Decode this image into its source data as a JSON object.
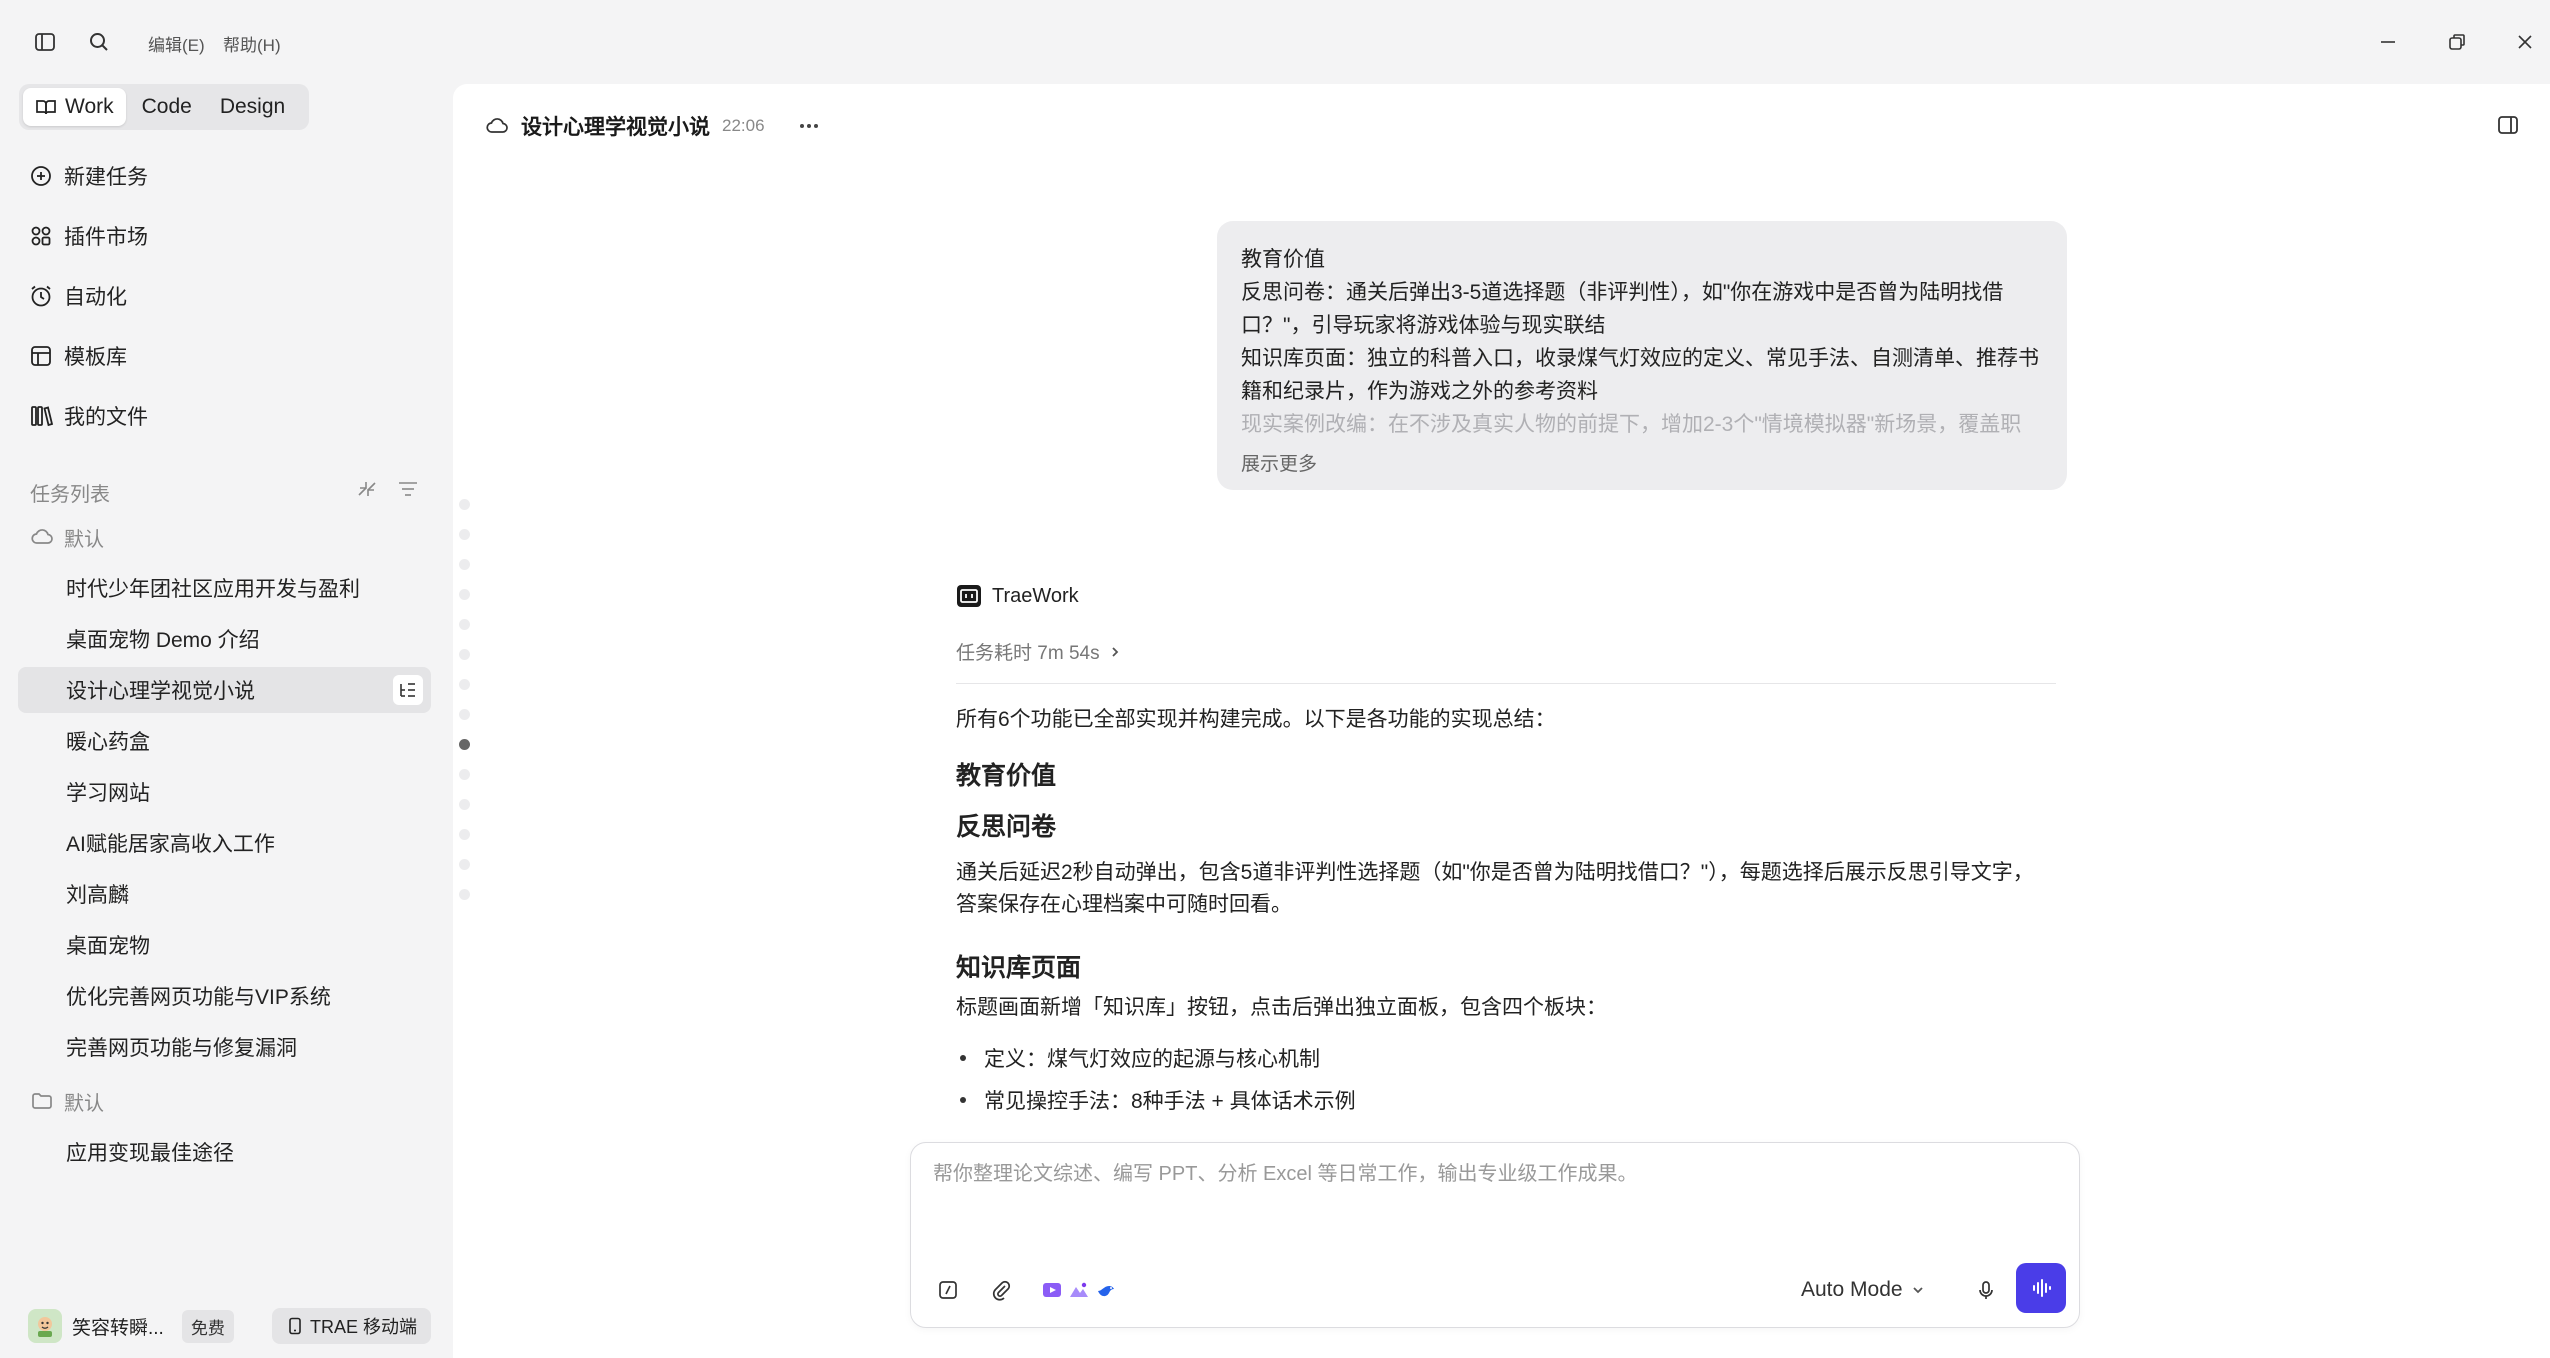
{
  "menu": {
    "edit": "编辑(E)",
    "help": "帮助(H)"
  },
  "modes": [
    "Work",
    "Code",
    "Design"
  ],
  "nav": [
    {
      "label": "新建任务",
      "icon": "plus-circle-icon"
    },
    {
      "label": "插件市场",
      "icon": "plugins-icon"
    },
    {
      "label": "自动化",
      "icon": "clock-icon"
    },
    {
      "label": "模板库",
      "icon": "template-icon"
    },
    {
      "label": "我的文件",
      "icon": "files-icon"
    }
  ],
  "task_list": {
    "label": "任务列表",
    "groups": [
      {
        "label": "默认",
        "icon": "cloud-icon",
        "items": [
          "时代少年团社区应用开发与盈利",
          "桌面宠物 Demo 介绍",
          "设计心理学视觉小说",
          "暖心药盒",
          "学习网站",
          "AI赋能居家高收入工作",
          "刘高麟",
          "桌面宠物",
          "优化完善网页功能与VIP系统",
          "完善网页功能与修复漏洞"
        ]
      },
      {
        "label": "默认",
        "icon": "folder-icon",
        "items": [
          "应用变现最佳途径"
        ]
      }
    ],
    "active": "设计心理学视觉小说"
  },
  "footer": {
    "user_name": "笑容转瞬...",
    "plan": "免费",
    "mobile": "TRAE 移动端"
  },
  "header": {
    "title": "设计心理学视觉小说",
    "time": "22:06"
  },
  "user_message": {
    "lines": [
      "教育价值",
      "反思问卷：通关后弹出3-5道选择题（非评判性），如\"你在游戏中是否曾为陆明找借",
      "口？\"，引导玩家将游戏体验与现实联结",
      "知识库页面：独立的科普入口，收录煤气灯效应的定义、常见手法、自测清单、推荐书",
      "籍和纪录片，作为游戏之外的参考资料",
      "现实案例改编：在不涉及真实人物的前提下，增加2-3个\"情境模拟器\"新场景，覆盖职"
    ],
    "show_more": "展示更多"
  },
  "assistant": {
    "name": "TraeWork",
    "duration": "任务耗时 7m 54s",
    "intro": "所有6个功能已全部实现并构建完成。以下是各功能的实现总结：",
    "h1": "教育价值",
    "h2": "反思问卷",
    "p1a": "通关后延迟2秒自动弹出，包含5道非评判性选择题（如\"你是否曾为陆明找借口？\"），每题选择后展示反思引导文字，",
    "p1b": "答案保存在心理档案中可随时回看。",
    "h3": "知识库页面",
    "p2": "标题画面新增「知识库」按钮，点击后弹出独立面板，包含四个板块：",
    "bullets": [
      "定义：煤气灯效应的起源与核心机制",
      "常见操控手法：8种手法 + 具体话术示例"
    ]
  },
  "composer": {
    "placeholder": "帮你整理论文综述、编写 PPT、分析 Excel 等日常工作，输出专业级工作成果。",
    "mode": "Auto Mode"
  },
  "colors": {
    "accent": "#4a3de8",
    "sidebar_bg": "#f4f4f5",
    "active_item_bg": "#e4e4e6"
  }
}
